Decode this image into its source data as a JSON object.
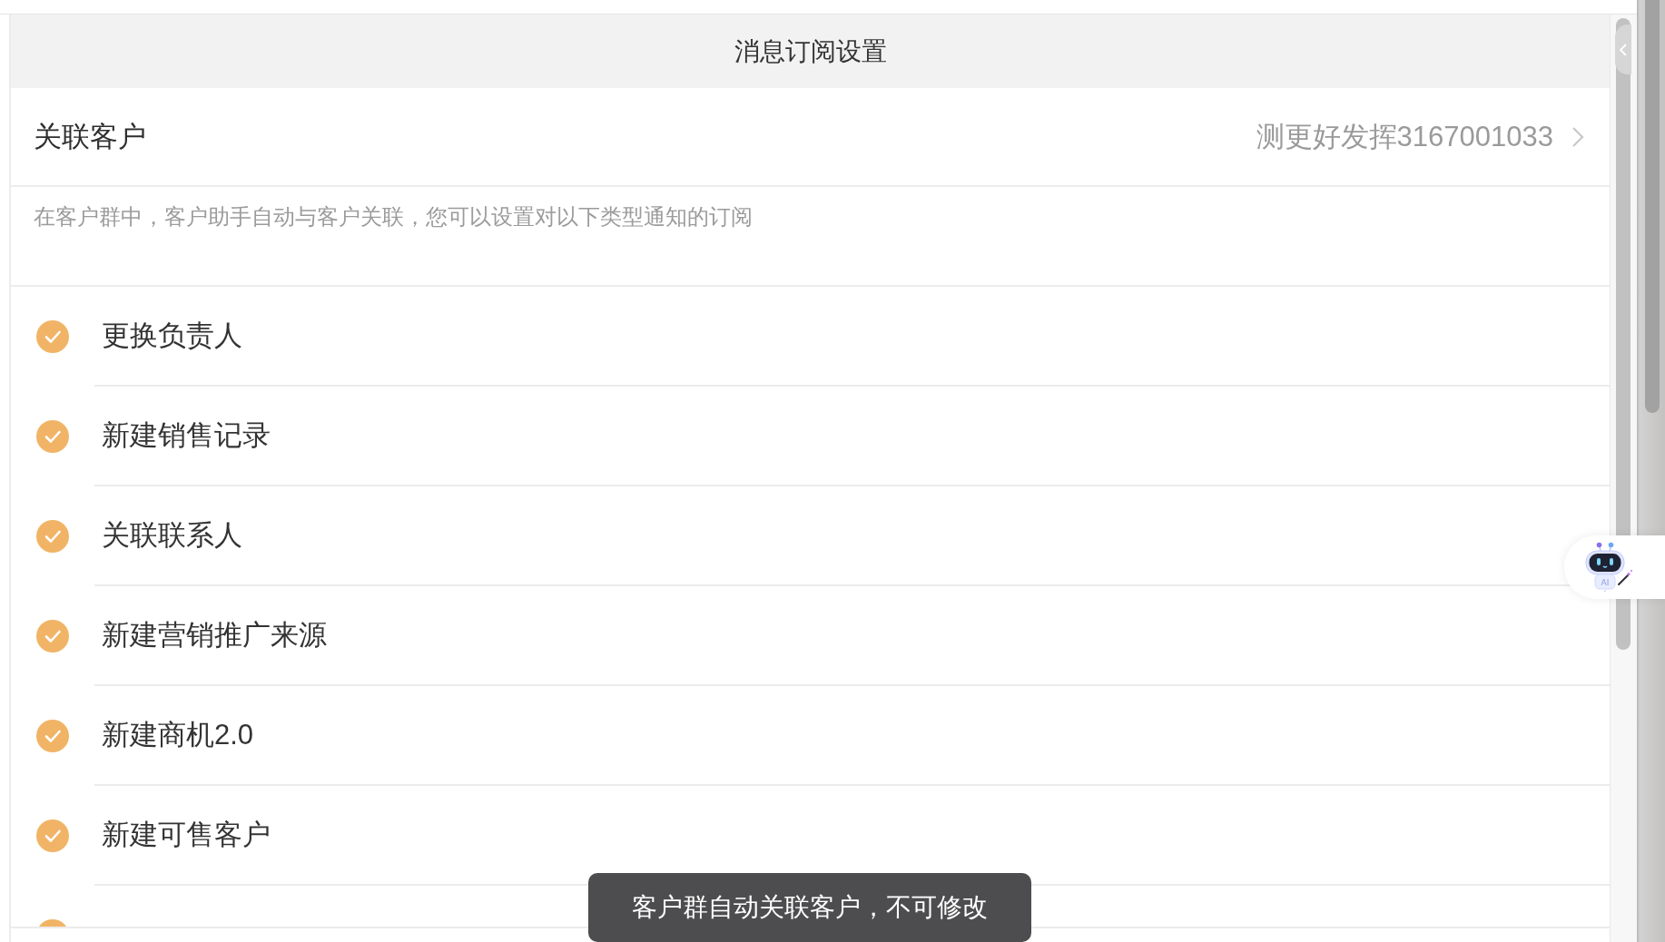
{
  "header": {
    "title": "消息订阅设置"
  },
  "linked_customer": {
    "label": "关联客户",
    "value": "测更好发挥3167001033"
  },
  "description": "在客户群中，客户助手自动与客户关联，您可以设置对以下类型通知的订阅",
  "subscriptions": [
    {
      "label": "更换负责人",
      "checked": true
    },
    {
      "label": "新建销售记录",
      "checked": true
    },
    {
      "label": "关联联系人",
      "checked": true
    },
    {
      "label": "新建营销推广来源",
      "checked": true
    },
    {
      "label": "新建商机2.0",
      "checked": true
    },
    {
      "label": "新建可售客户",
      "checked": true
    },
    {
      "checked": true
    }
  ],
  "assistant": {
    "badge": "AI"
  },
  "toast": "客户群自动关联客户，不可修改"
}
